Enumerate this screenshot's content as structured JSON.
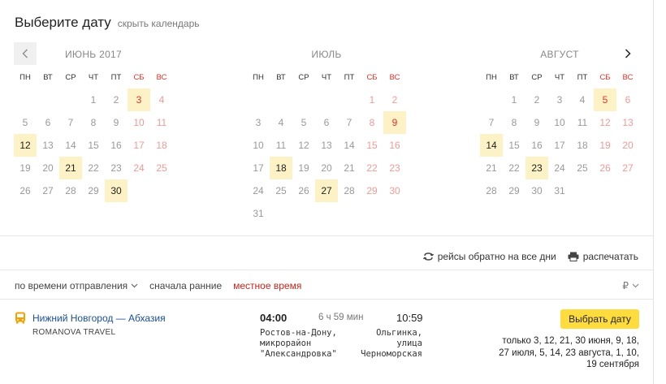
{
  "calendar": {
    "title": "Выберите дату",
    "hide_link": "скрыть календарь",
    "weekdays": [
      "ПН",
      "ВТ",
      "СР",
      "ЧТ",
      "ПТ",
      "СБ",
      "ВС"
    ],
    "months": [
      {
        "name": "ИЮНЬ 2017",
        "offset": 3,
        "days": 30,
        "selected": [
          3,
          12,
          21,
          30
        ],
        "nav": "prev"
      },
      {
        "name": "ИЮЛЬ",
        "offset": 5,
        "days": 31,
        "selected": [
          9,
          18,
          27
        ],
        "nav": ""
      },
      {
        "name": "АВГУСТ",
        "offset": 1,
        "days": 31,
        "selected": [
          5,
          14,
          23
        ],
        "nav": "next"
      }
    ]
  },
  "options": {
    "return_trips": "рейсы обратно на все дни",
    "print": "распечатать"
  },
  "sort": {
    "by_departure": "по времени отправления",
    "earliest_first": "сначала ранние",
    "local_time": "местное время",
    "currency": "₽"
  },
  "route": {
    "name": "Нижний Новгород — Абхазия",
    "carrier": "ROMANOVA TRAVEL",
    "departure_time": "04:00",
    "duration": "6 ч 59 мин",
    "arrival_time": "10:59",
    "departure_place": "Ростов-на-Дону,\nмикрорайон\n\"Александровка\"",
    "arrival_place": "Ольгинка, улица\nЧерноморская",
    "button": "Выбрать дату",
    "dates": "только 3, 12, 21, 30 июня, 9, 18, 27 июля, 5, 14, 23 августа, 1, 10, 19 сентября"
  },
  "colors": {
    "selected_bg": "#fdf2c6",
    "weekend": "#e2332b",
    "link": "#1a4ea0",
    "button": "#ffdc3d"
  }
}
